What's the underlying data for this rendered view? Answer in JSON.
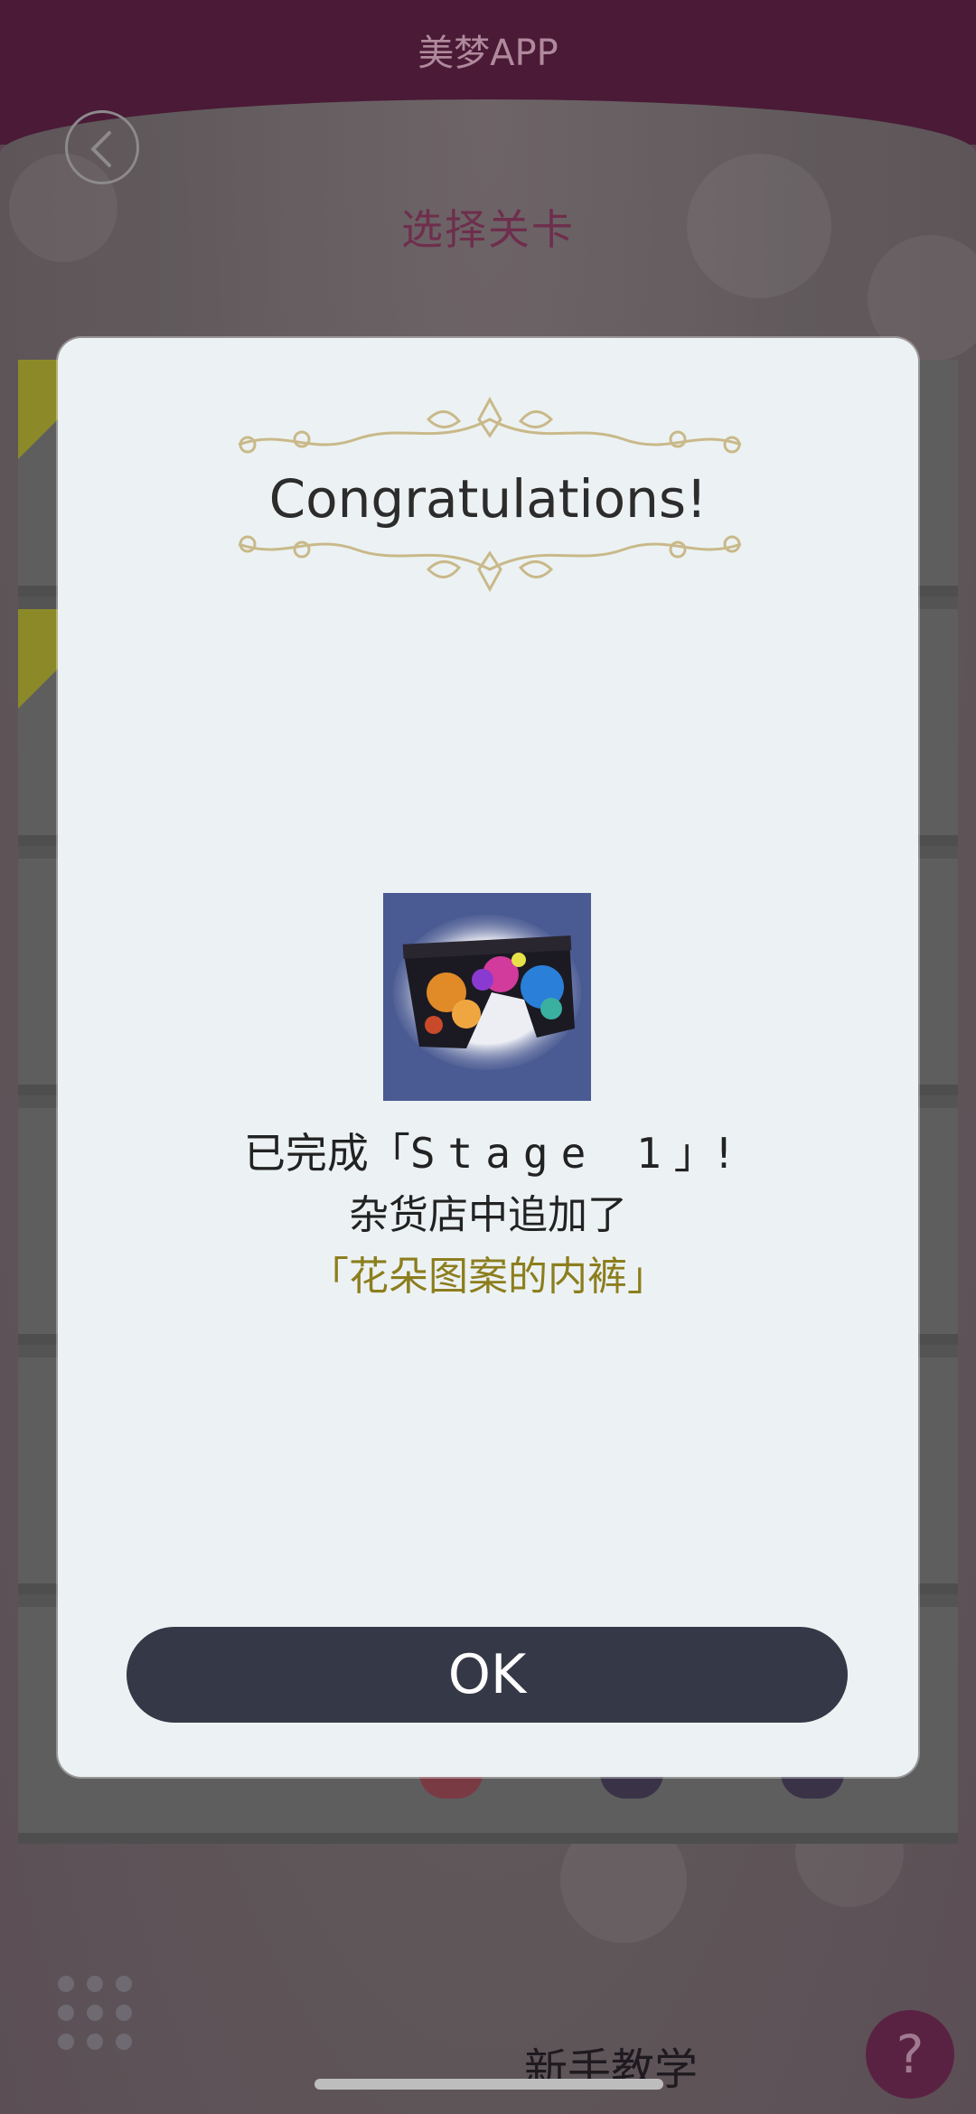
{
  "app": {
    "title": "美梦APP"
  },
  "header": {
    "back_label": "back",
    "page_title": "选择关卡"
  },
  "footer": {
    "tutorial_label": "新手教学",
    "help_label": "?"
  },
  "modal": {
    "heading": "Congratulations!",
    "prefix": "已完成「",
    "stage_name": "Stage 1",
    "suffix": "」!",
    "line2": "杂货店中追加了",
    "reward_item": "「花朵图案的内裤」",
    "reward_image_icon": "underwear-floral-image",
    "ok_label": "OK"
  },
  "colors": {
    "header_bg": "#4a1a36",
    "modal_bg": "#ecf2f3",
    "ok_button": "#353846",
    "reward_text": "#8c7e1e",
    "ornament": "#c9b98a"
  }
}
